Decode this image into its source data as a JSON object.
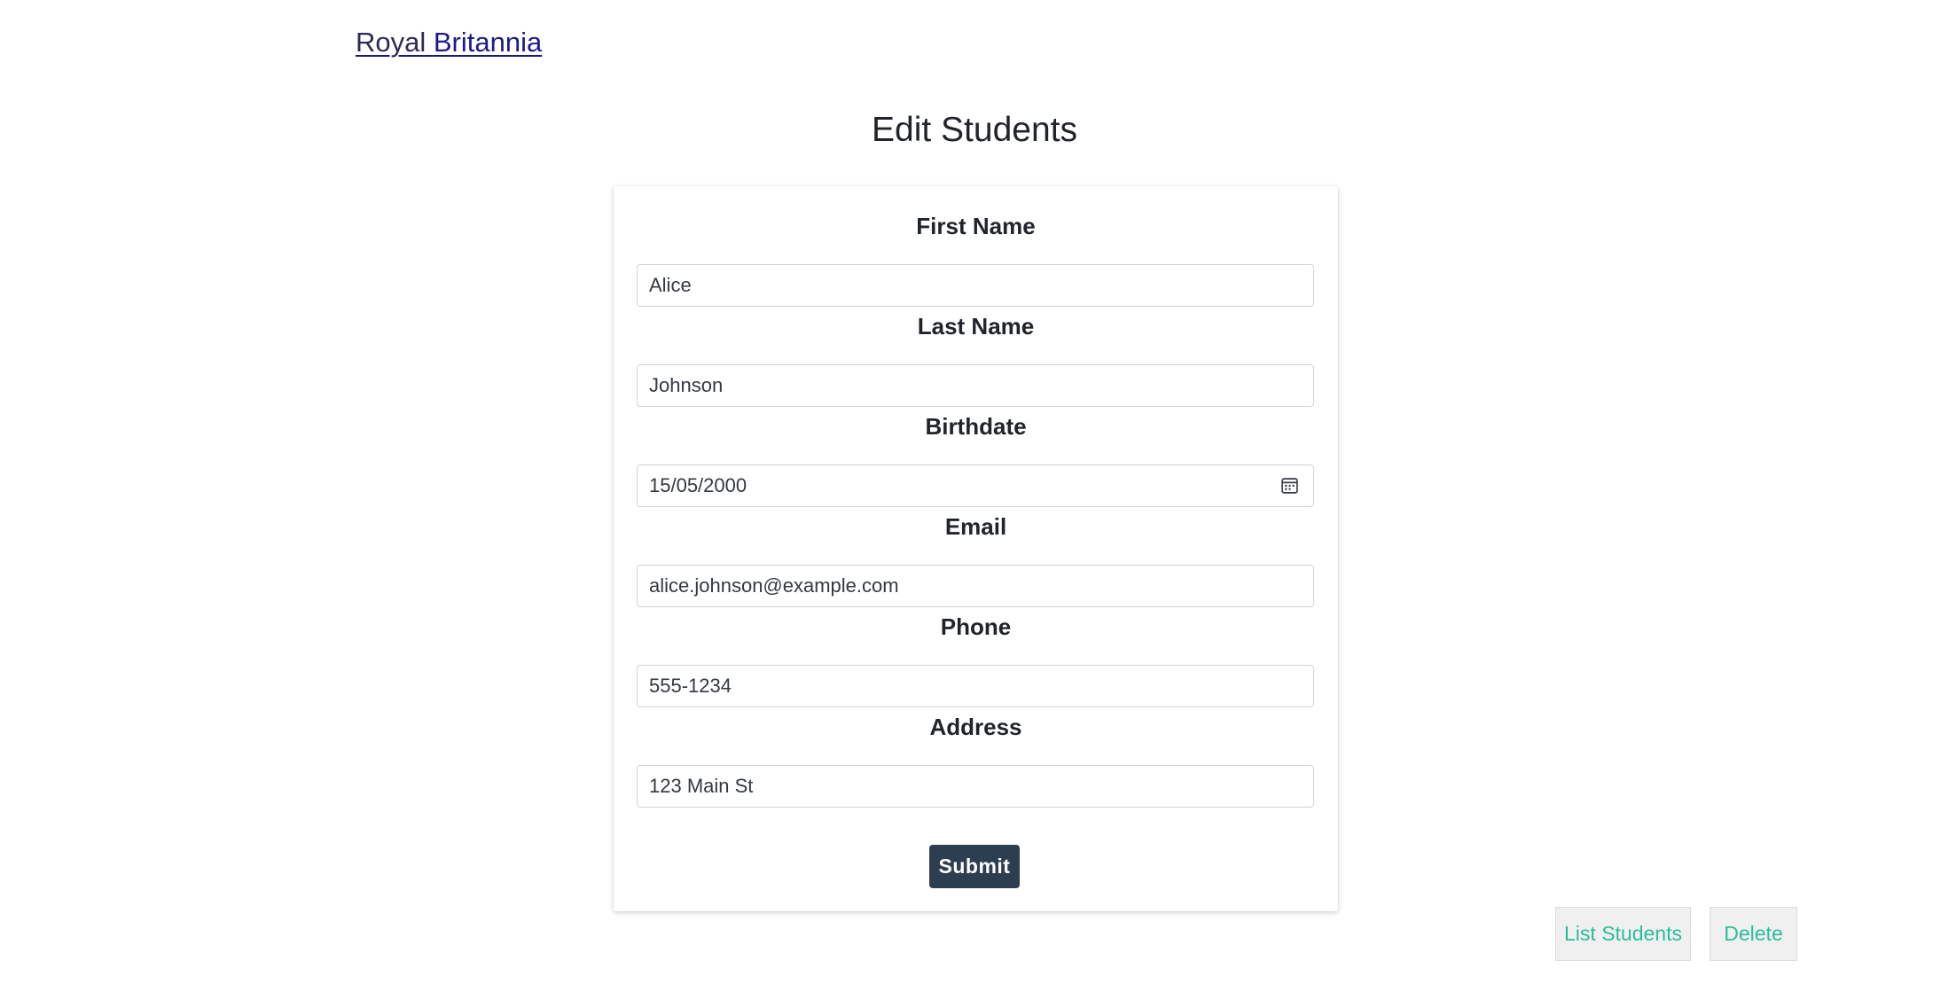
{
  "header": {
    "brand_part1": "Royal ",
    "brand_part2": "Britannia"
  },
  "page": {
    "title": "Edit Students"
  },
  "form": {
    "first_name": {
      "label": "First Name",
      "value": "Alice"
    },
    "last_name": {
      "label": "Last Name",
      "value": "Johnson"
    },
    "birthdate": {
      "label": "Birthdate",
      "value": "15/05/2000"
    },
    "email": {
      "label": "Email",
      "value": "alice.johnson@example.com"
    },
    "phone": {
      "label": "Phone",
      "value": "555-1234"
    },
    "address": {
      "label": "Address",
      "value": "123 Main St"
    },
    "submit_label": "Submit"
  },
  "actions": {
    "list_label": "List Students",
    "delete_label": "Delete"
  },
  "colors": {
    "submit_bg": "#2c3e50",
    "action_text": "#2bbd9a",
    "brand": "#1a1a8c"
  },
  "icons": {
    "birthdate_icon": "calendar-icon"
  }
}
